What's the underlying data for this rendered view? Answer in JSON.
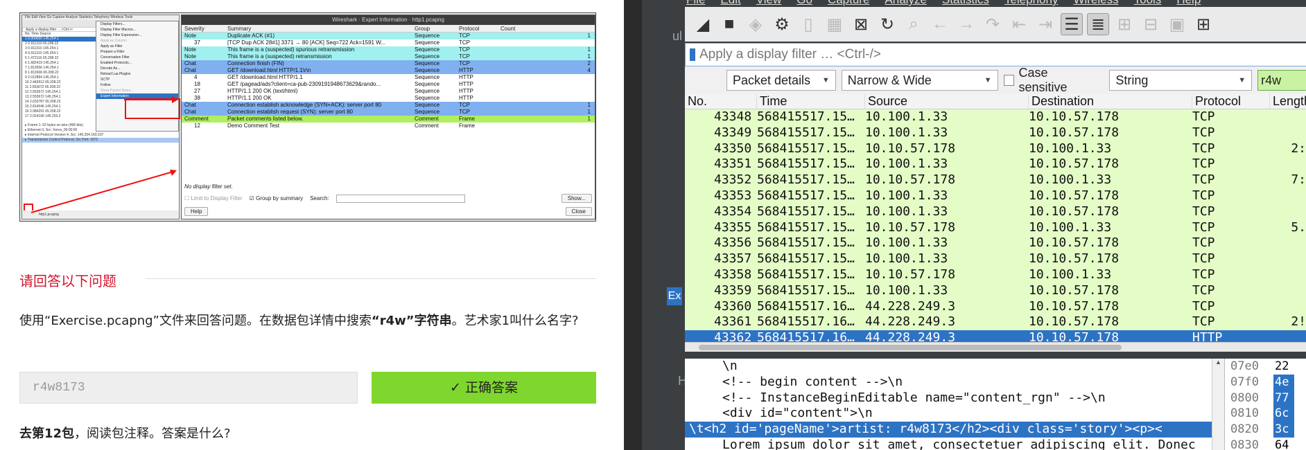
{
  "thumbnail": {
    "title": "Wireshark · Expert Information · http1.pcapng",
    "columns": [
      "Severity",
      "Summary",
      "Group",
      "Protocol",
      "Count"
    ],
    "rows": [
      {
        "sev": "Note",
        "sum": "Duplicate ACK (#1)",
        "grp": "Sequence",
        "proto": "TCP",
        "cnt": "1",
        "bg": "#a0f0f0"
      },
      {
        "sev": "37",
        "sum": "[TCP Dup ACK 28#1] 3371 → 80 [ACK] Seq=722 Ack=1591 W...",
        "grp": "Sequence",
        "proto": "TCP",
        "cnt": "",
        "bg": "#ffffff"
      },
      {
        "sev": "Note",
        "sum": "This frame is a (suspected) spurious retransmission",
        "grp": "Sequence",
        "proto": "TCP",
        "cnt": "1",
        "bg": "#a0f0f0"
      },
      {
        "sev": "Note",
        "sum": "This frame is a (suspected) retransmission",
        "grp": "Sequence",
        "proto": "TCP",
        "cnt": "1",
        "bg": "#a0f0f0"
      },
      {
        "sev": "Chat",
        "sum": "Connection finish (FIN)",
        "grp": "Sequence",
        "proto": "TCP",
        "cnt": "2",
        "bg": "#80b0f0"
      },
      {
        "sev": "Chat",
        "sum": "GET /download.html HTTP/1.1\\r\\n",
        "grp": "Sequence",
        "proto": "HTTP",
        "cnt": "4",
        "bg": "#80b0f0"
      },
      {
        "sev": "4",
        "sum": "GET /download.html HTTP/1.1",
        "grp": "Sequence",
        "proto": "HTTP",
        "cnt": "",
        "bg": "#ffffff"
      },
      {
        "sev": "18",
        "sum": "GET /pagead/ads?client=ca-pub-2309191948673629&rando...",
        "grp": "Sequence",
        "proto": "HTTP",
        "cnt": "",
        "bg": "#ffffff"
      },
      {
        "sev": "27",
        "sum": "HTTP/1.1 200 OK (text/html)",
        "grp": "Sequence",
        "proto": "HTTP",
        "cnt": "",
        "bg": "#ffffff"
      },
      {
        "sev": "38",
        "sum": "HTTP/1.1 200 OK",
        "grp": "Sequence",
        "proto": "HTTP",
        "cnt": "",
        "bg": "#ffffff"
      },
      {
        "sev": "Chat",
        "sum": "Connection establish acknowledge (SYN+ACK): server port 80",
        "grp": "Sequence",
        "proto": "TCP",
        "cnt": "1",
        "bg": "#80b0f0"
      },
      {
        "sev": "Chat",
        "sum": "Connection establish request (SYN): server port 80",
        "grp": "Sequence",
        "proto": "TCP",
        "cnt": "1",
        "bg": "#80b0f0"
      },
      {
        "sev": "Comment",
        "sum": "Packet comments listed below.",
        "grp": "Comment",
        "proto": "Frame",
        "cnt": "1",
        "bg": "#b0f060"
      },
      {
        "sev": "12",
        "sum": "Demo Comment Test",
        "grp": "Comment",
        "proto": "Frame",
        "cnt": "",
        "bg": "#ffffff"
      }
    ],
    "footer_status": "No display filter set.",
    "limit_label": "Limit to Display Filter",
    "group_label": "Group by summary",
    "search_label": "Search:",
    "show_btn": "Show...",
    "help_btn": "Help",
    "close_btn": "Close",
    "mini_status": "http1.pcapng"
  },
  "question_section": {
    "heading": "请回答以下问题",
    "q1_text_a": "使用“Exercise.pcapng”文件来回答问题。在数据包详情中搜索",
    "q1_bold": "“r4w”字符串",
    "q1_text_b": "。艺术家1叫什么名字?",
    "answer_value": "r4w8173",
    "correct_button": "✓ 正确答案",
    "q2_bold": "去第12包",
    "q2_text": "，阅读包注释。答案是什么?"
  },
  "wireshark": {
    "menu": [
      "File",
      "Edit",
      "View",
      "Go",
      "Capture",
      "Analyze",
      "Statistics",
      "Telephony",
      "Wireless",
      "Tools",
      "Help"
    ],
    "filter_placeholder": "Apply a display filter … <Ctrl-/>",
    "find": {
      "search_in": "Packet details",
      "char_width": "Narrow & Wide",
      "case_label": "Case sensitive",
      "type": "String",
      "value": "r4w"
    },
    "columns": [
      "No.",
      "Time",
      "Source",
      "Destination",
      "Protocol",
      "Length"
    ],
    "packets": [
      {
        "no": "43348",
        "time": "568415517.15…",
        "src": "10.100.1.33",
        "dst": "10.10.57.178",
        "proto": "TCP",
        "len": ""
      },
      {
        "no": "43349",
        "time": "568415517.15…",
        "src": "10.100.1.33",
        "dst": "10.10.57.178",
        "proto": "TCP",
        "len": ""
      },
      {
        "no": "43350",
        "time": "568415517.15…",
        "src": "10.10.57.178",
        "dst": "10.100.1.33",
        "proto": "TCP",
        "len": "2:"
      },
      {
        "no": "43351",
        "time": "568415517.15…",
        "src": "10.100.1.33",
        "dst": "10.10.57.178",
        "proto": "TCP",
        "len": ""
      },
      {
        "no": "43352",
        "time": "568415517.15…",
        "src": "10.10.57.178",
        "dst": "10.100.1.33",
        "proto": "TCP",
        "len": "7:"
      },
      {
        "no": "43353",
        "time": "568415517.15…",
        "src": "10.100.1.33",
        "dst": "10.10.57.178",
        "proto": "TCP",
        "len": ""
      },
      {
        "no": "43354",
        "time": "568415517.15…",
        "src": "10.100.1.33",
        "dst": "10.10.57.178",
        "proto": "TCP",
        "len": ""
      },
      {
        "no": "43355",
        "time": "568415517.15…",
        "src": "10.10.57.178",
        "dst": "10.100.1.33",
        "proto": "TCP",
        "len": "5."
      },
      {
        "no": "43356",
        "time": "568415517.15…",
        "src": "10.100.1.33",
        "dst": "10.10.57.178",
        "proto": "TCP",
        "len": ""
      },
      {
        "no": "43357",
        "time": "568415517.15…",
        "src": "10.100.1.33",
        "dst": "10.10.57.178",
        "proto": "TCP",
        "len": ""
      },
      {
        "no": "43358",
        "time": "568415517.15…",
        "src": "10.10.57.178",
        "dst": "10.100.1.33",
        "proto": "TCP",
        "len": ""
      },
      {
        "no": "43359",
        "time": "568415517.15…",
        "src": "10.100.1.33",
        "dst": "10.10.57.178",
        "proto": "TCP",
        "len": ""
      },
      {
        "no": "43360",
        "time": "568415517.16…",
        "src": "44.228.249.3",
        "dst": "10.10.57.178",
        "proto": "TCP",
        "len": ""
      },
      {
        "no": "43361",
        "time": "568415517.16…",
        "src": "44.228.249.3",
        "dst": "10.10.57.178",
        "proto": "TCP",
        "len": "2!"
      },
      {
        "no": "43362",
        "time": "568415517.16…",
        "src": "44.228.249.3",
        "dst": "10.10.57.178",
        "proto": "HTTP",
        "len": ""
      }
    ],
    "detail_lines": [
      "\\n",
      "<!-- begin content -->\\n",
      "<!-- InstanceBeginEditable name=\"content_rgn\" -->\\n",
      "<div id=\"content\">\\n",
      "\\t<h2 id='pageName'>artist: r4w8173</h2><div class='story'><p><",
      "Lorem ipsum dolor sit amet, consectetuer adipiscing elit. Donec"
    ],
    "hex_rows": [
      {
        "off": "07e0",
        "b": "22",
        "hi": false
      },
      {
        "off": "07f0",
        "b": "4e",
        "hi": true
      },
      {
        "off": "0800",
        "b": "77",
        "hi": true
      },
      {
        "off": "0810",
        "b": "6c",
        "hi": true
      },
      {
        "off": "0820",
        "b": "3c",
        "hi": true
      },
      {
        "off": "0830",
        "b": "64",
        "hi": false
      }
    ],
    "bg_fragments": {
      "a": "ul",
      "b": "H",
      "c": "Ex"
    }
  }
}
